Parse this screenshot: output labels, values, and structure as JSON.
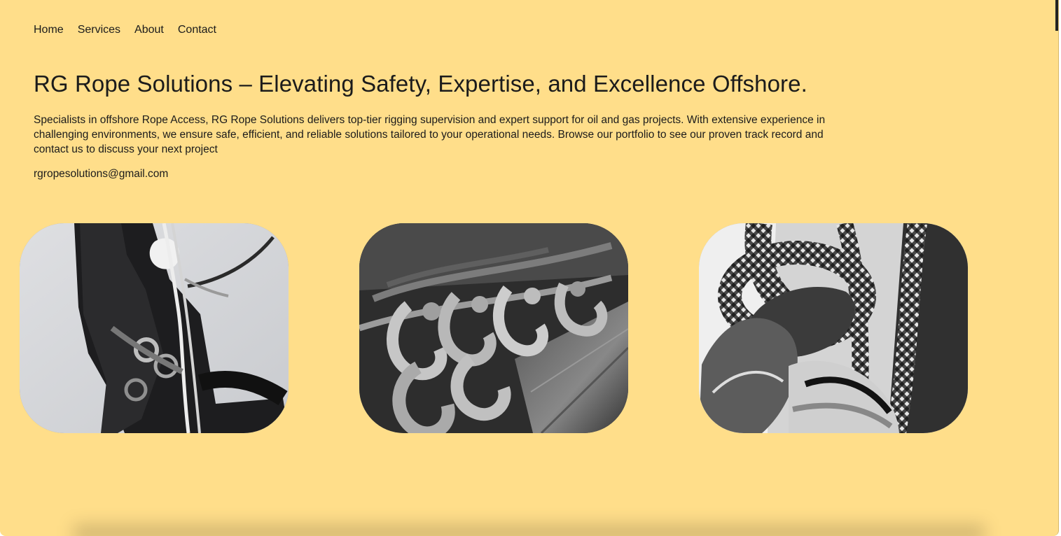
{
  "nav": {
    "items": [
      {
        "label": "Home"
      },
      {
        "label": "Services"
      },
      {
        "label": "About"
      },
      {
        "label": "Contact"
      }
    ]
  },
  "hero": {
    "brand": "RG Rope Solutions",
    "tagline": " – Elevating Safety, Expertise, and Excellence Offshore.",
    "description": "Specialists in offshore Rope Access, RG Rope Solutions delivers top-tier rigging supervision and expert support for oil and gas projects. With extensive experience in challenging environments, we ensure safe, efficient, and reliable solutions tailored to your operational needs. Browse our portfolio to see our proven track record and contact us to discuss your next project",
    "email": "rgropesolutions@gmail.com"
  },
  "gallery": {
    "images": [
      {
        "name": "rope-access-worker-photo"
      },
      {
        "name": "rigging-hooks-photo"
      },
      {
        "name": "climbing-rope-knot-photo"
      }
    ]
  },
  "colors": {
    "background": "#ffde8a",
    "text": "#1b1b1b"
  }
}
